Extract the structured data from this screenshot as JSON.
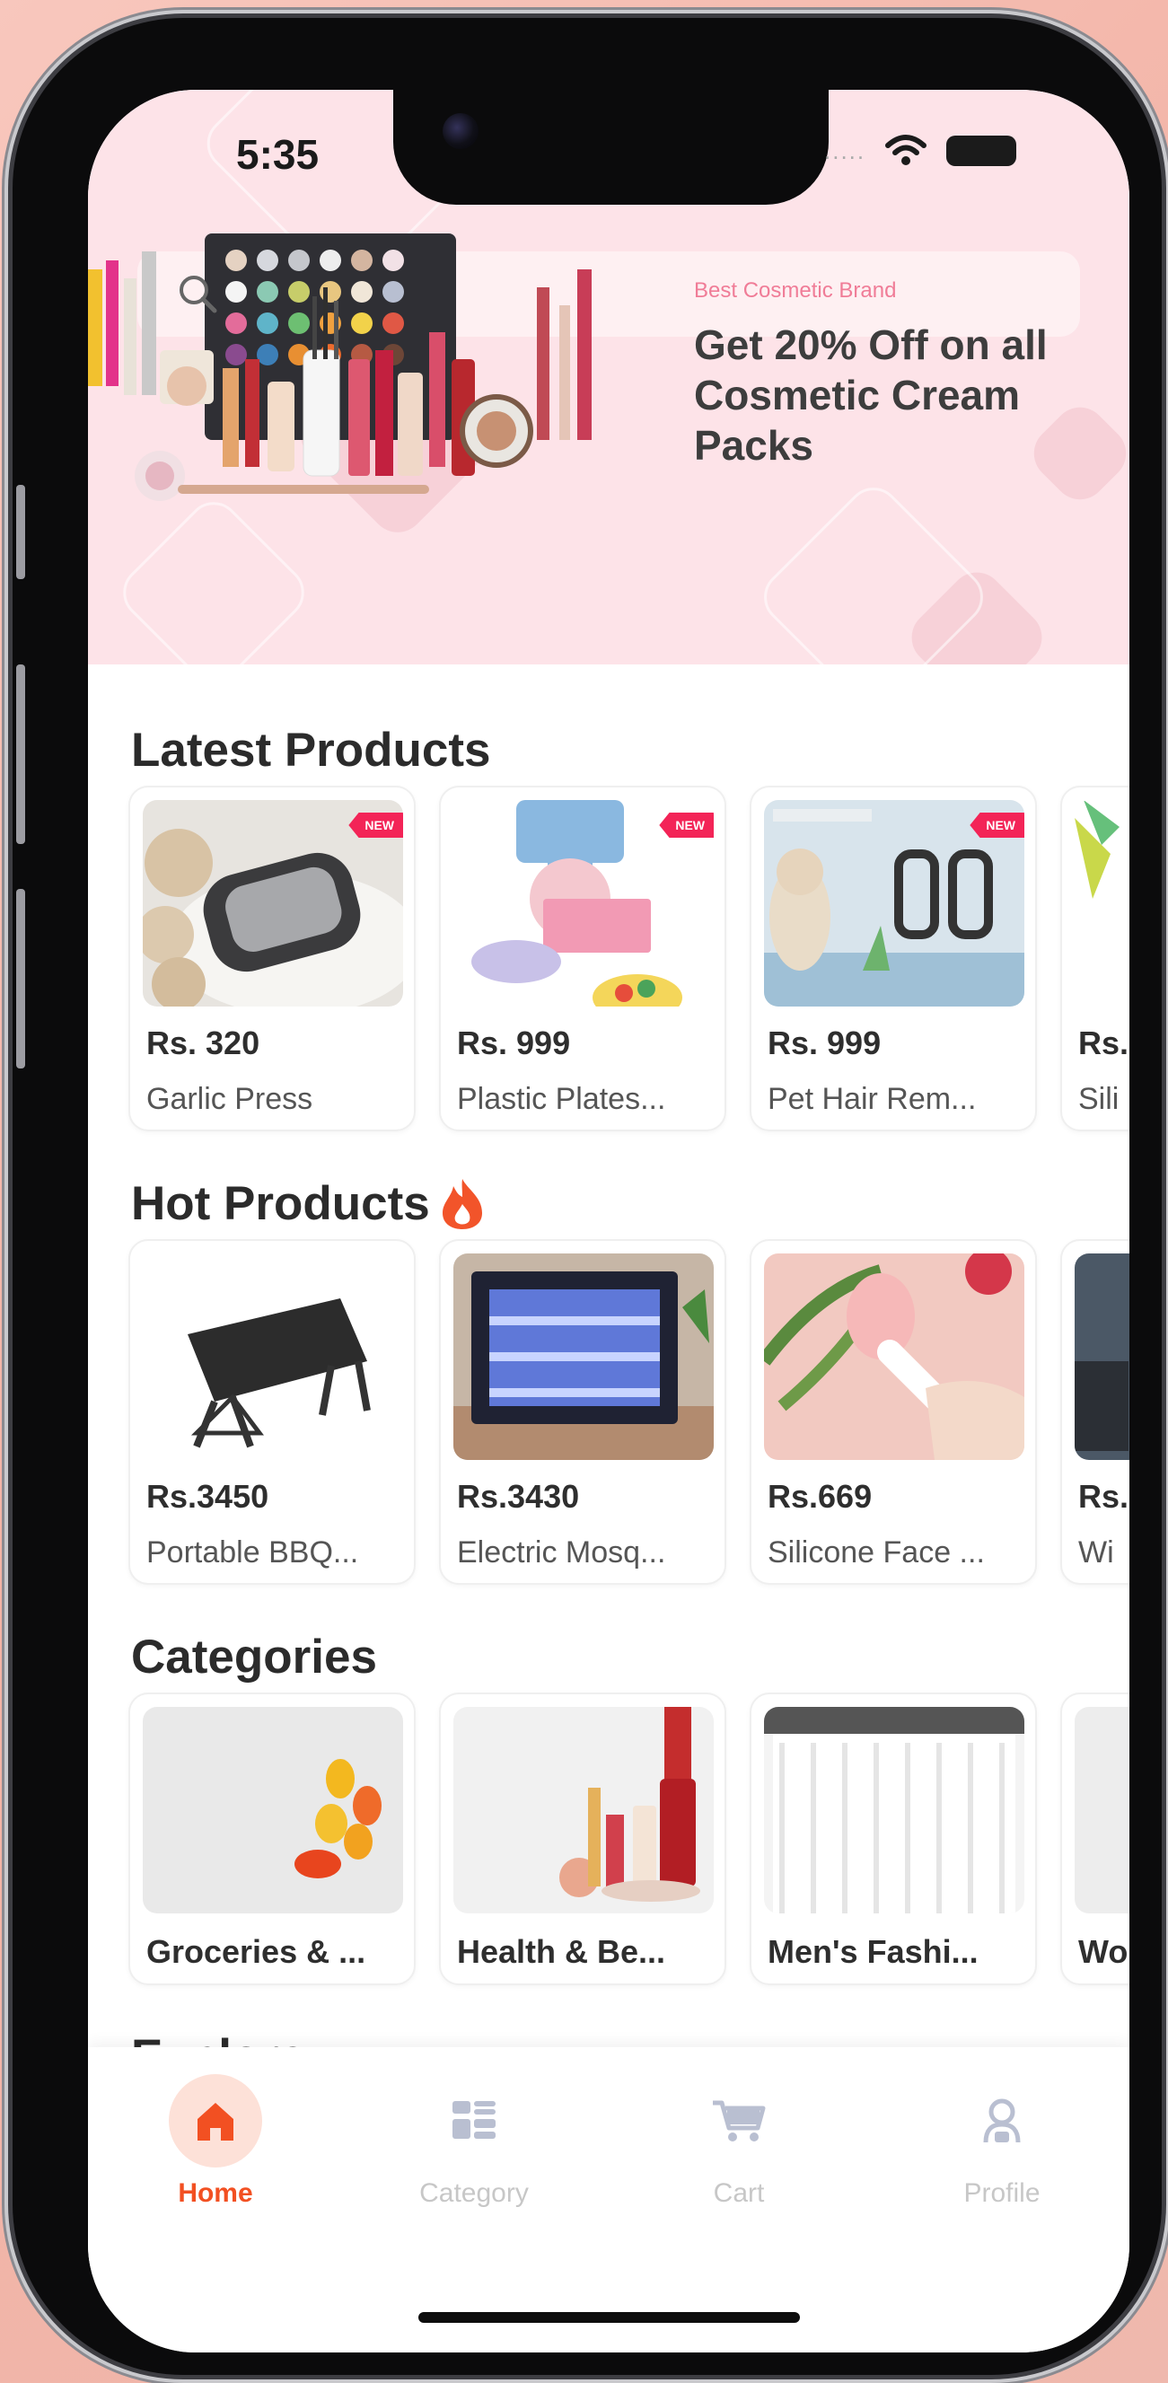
{
  "status_bar": {
    "time": "5:35",
    "signal_dots": "....."
  },
  "banner": {
    "tag": "Best Cosmetic Brand",
    "title": "Get 20% Off on all Cosmetic Cream Packs"
  },
  "latest_products": {
    "title": "Latest Products",
    "badge": "NEW",
    "items": [
      {
        "price": "Rs. 320",
        "name": "Garlic Press"
      },
      {
        "price": "Rs. 999",
        "name": "Plastic Plates..."
      },
      {
        "price": "Rs. 999",
        "name": "Pet Hair Rem..."
      },
      {
        "price": "Rs.",
        "name": "Sili"
      }
    ]
  },
  "hot_products": {
    "title": "Hot Products",
    "items": [
      {
        "price": "Rs.3450",
        "name": "Portable BBQ..."
      },
      {
        "price": "Rs.3430",
        "name": "Electric Mosq..."
      },
      {
        "price": "Rs.669",
        "name": "Silicone Face ..."
      },
      {
        "price": "Rs.",
        "name": "Wi"
      }
    ]
  },
  "categories": {
    "title": "Categories",
    "items": [
      {
        "name": "Groceries & ..."
      },
      {
        "name": "Health & Be..."
      },
      {
        "name": "Men's Fashi..."
      },
      {
        "name": "Wo"
      }
    ]
  },
  "explore": {
    "title": "Explore"
  },
  "bottom_nav": {
    "items": [
      {
        "label": "Home",
        "icon": "home-icon",
        "active": true
      },
      {
        "label": "Category",
        "icon": "grid-icon",
        "active": false
      },
      {
        "label": "Cart",
        "icon": "cart-icon",
        "active": false
      },
      {
        "label": "Profile",
        "icon": "profile-icon",
        "active": false
      }
    ]
  },
  "colors": {
    "accent": "#f25022",
    "badge": "#f32457",
    "banner_bg": "#fde3e8",
    "promo_tag": "#f07c97"
  }
}
